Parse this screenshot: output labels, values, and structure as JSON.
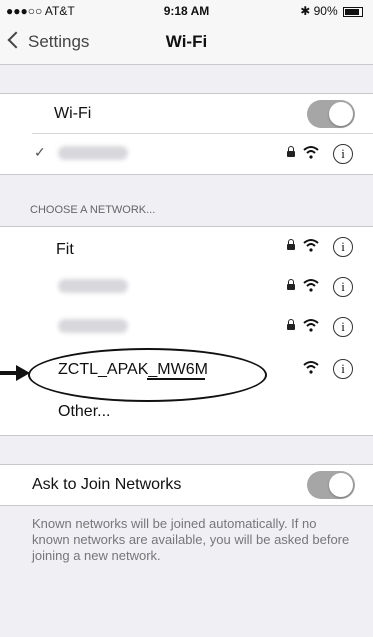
{
  "status": {
    "carrier": "●●●○○ AT&T",
    "time": "9:18 AM",
    "battery": "90%"
  },
  "nav": {
    "back_label": "Settings",
    "title": "Wi-Fi"
  },
  "wifi_toggle": {
    "label": "Wi-Fi"
  },
  "section_header": "CHOOSE A NETWORK...",
  "networks": [
    {
      "name": "Fit",
      "locked": true
    },
    {
      "name": "ZCTL_APAK_MW6M",
      "locked": false
    },
    {
      "name": "Other...",
      "locked": false
    }
  ],
  "ask_to_join": {
    "label": "Ask to Join Networks",
    "footer": "Known networks will be joined automatically. If no known networks are available, you will be asked before joining a new network."
  },
  "colors": {
    "toggle_on": "#a6a6a6",
    "background": "#efeff4"
  }
}
